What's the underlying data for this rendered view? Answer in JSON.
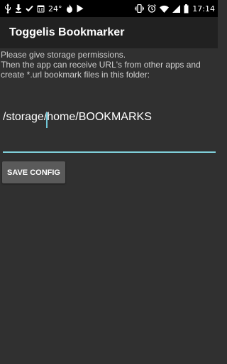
{
  "status_bar": {
    "temperature": "24°",
    "time": "17:14",
    "left_icons": [
      "usb-icon",
      "download-icon",
      "check-icon",
      "calendar-icon",
      "temperature",
      "fire-icon",
      "play-store-icon"
    ],
    "right_icons": [
      "vibrate-icon",
      "alarm-icon",
      "wifi-icon",
      "signal-icon",
      "battery-icon"
    ],
    "calendar_day": "10"
  },
  "app_bar": {
    "title": "Toggelis Bookmarker"
  },
  "main": {
    "message": "Please give storage permissions.\n Then the app can receive URL's from other apps and create *.url bookmark files in this folder:",
    "path_value": "/storage/home/BOOKMARKS",
    "save_button_label": "SAVE CONFIG"
  },
  "colors": {
    "background": "#303030",
    "app_bar": "#212121",
    "accent": "#7fcfd9",
    "button": "#5a5a5a"
  }
}
